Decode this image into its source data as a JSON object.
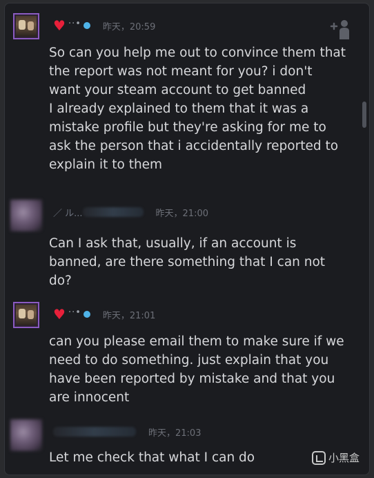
{
  "conversation": {
    "messages": [
      {
        "sender": "friend",
        "timestamp": "昨天，20:59",
        "paragraphs": [
          "So can you help me out to convince them that the report was not meant for you? i don't want your steam account to get banned",
          "I already explained to them that it was a mistake profile but they're asking for me to ask the person that i accidentally reported to explain it to them"
        ]
      },
      {
        "sender": "me",
        "name_fragment": "／ ル...",
        "timestamp": "昨天，21:00",
        "paragraphs": [
          "Can I ask that, usually, if an account is banned, are there something that I can not do?"
        ]
      },
      {
        "sender": "friend",
        "timestamp": "昨天，21:01",
        "paragraphs": [
          "can you please email them to make sure if we need to do something. just explain that you have been reported by mistake and that you are innocent"
        ]
      },
      {
        "sender": "me",
        "timestamp": "昨天，21:03",
        "paragraphs": [
          "Let me check that what I can do"
        ]
      }
    ]
  },
  "icons": {
    "friend_name_heart": "heart-icon",
    "friend_name_dots": "··•",
    "add_friend": "add-friend-icon"
  },
  "colors": {
    "background": "#1b1c20",
    "text": "#d7d8db",
    "timestamp": "#6d7078",
    "heart": "#e8203a",
    "online_dot": "#4fb3e8",
    "avatar_border": "#8b5bc1"
  },
  "watermark": {
    "text": "小黑盒"
  }
}
